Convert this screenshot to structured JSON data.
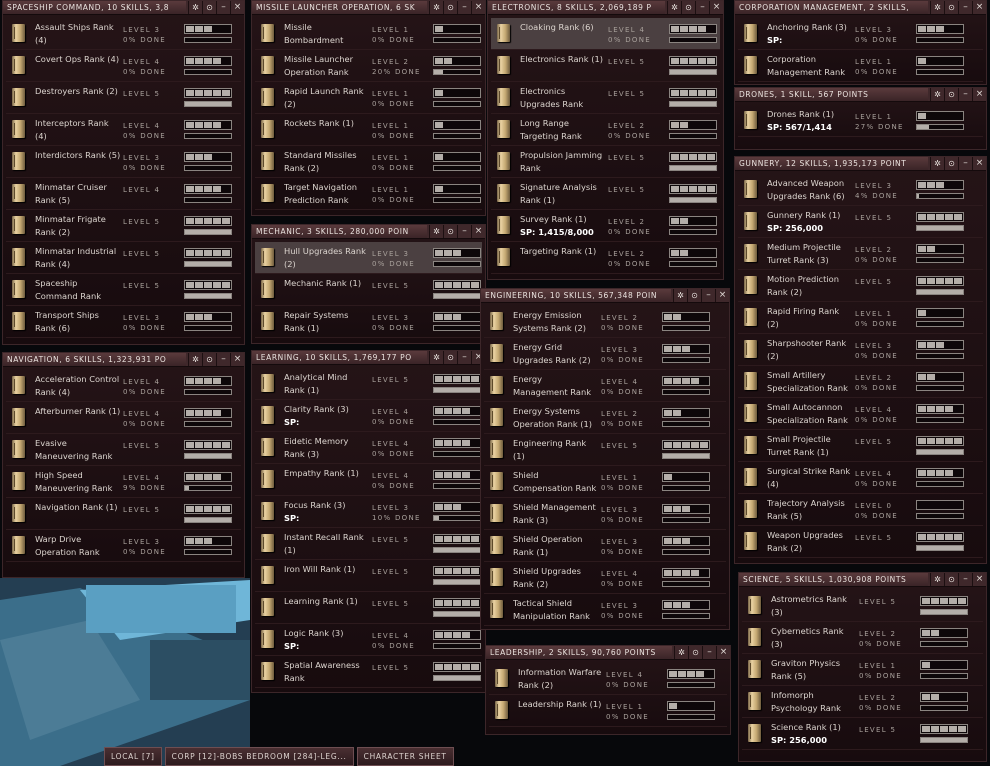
{
  "background": {
    "colors": {
      "space": "#07080b",
      "hull": "#3b6e8a"
    }
  },
  "taskbar": [
    "LOCAL [7]",
    "CORP [12]-BOBS BEDROOM [284]-LEG...",
    "CHARACTER SHEET"
  ],
  "windows": [
    {
      "title": "SPACESHIP COMMAND, 10 SKILLS, 3,8",
      "skills": [
        {
          "name": "Assault Ships Rank (4)",
          "level": "LEVEL 3",
          "level_num": 3,
          "done": "0% DONE",
          "pct": 0
        },
        {
          "name": "Covert Ops Rank (4)",
          "level": "LEVEL 4",
          "level_num": 4,
          "done": "0% DONE",
          "pct": 0
        },
        {
          "name": "Destroyers Rank (2)",
          "level": "LEVEL 5",
          "level_num": 5,
          "done": "",
          "pct": 0
        },
        {
          "name": "Interceptors Rank (4)",
          "level": "LEVEL 4",
          "level_num": 4,
          "done": "0% DONE",
          "pct": 0
        },
        {
          "name": "Interdictors Rank (5)",
          "level": "LEVEL 3",
          "level_num": 3,
          "done": "0% DONE",
          "pct": 0
        },
        {
          "name": "Minmatar Cruiser Rank (5)",
          "level": "LEVEL 4",
          "level_num": 4,
          "done": "",
          "pct": 0
        },
        {
          "name": "Minmatar Frigate Rank (2)",
          "level": "LEVEL 5",
          "level_num": 5,
          "done": "",
          "pct": 0
        },
        {
          "name": "Minmatar Industrial Rank (4)",
          "level": "LEVEL 5",
          "level_num": 5,
          "done": "",
          "pct": 0
        },
        {
          "name": "Spaceship Command Rank",
          "level": "LEVEL 5",
          "level_num": 5,
          "done": "",
          "pct": 0
        },
        {
          "name": "Transport Ships Rank (6)",
          "level": "LEVEL 3",
          "level_num": 3,
          "done": "0% DONE",
          "pct": 0
        }
      ]
    },
    {
      "title": "NAVIGATION, 6 SKILLS, 1,323,931 PO",
      "skills": [
        {
          "name": "Acceleration Control Rank (4)",
          "level": "LEVEL 4",
          "level_num": 4,
          "done": "0% DONE",
          "pct": 0
        },
        {
          "name": "Afterburner Rank (1)",
          "level": "LEVEL 4",
          "level_num": 4,
          "done": "0% DONE",
          "pct": 0
        },
        {
          "name": "Evasive Maneuvering Rank",
          "level": "LEVEL 5",
          "level_num": 5,
          "done": "",
          "pct": 0
        },
        {
          "name": "High Speed Maneuvering Rank",
          "level": "LEVEL 4",
          "level_num": 4,
          "done": "9% DONE",
          "pct": 9
        },
        {
          "name": "Navigation Rank (1)",
          "level": "LEVEL 5",
          "level_num": 5,
          "done": "",
          "pct": 0
        },
        {
          "name": "Warp Drive Operation Rank",
          "level": "LEVEL 3",
          "level_num": 3,
          "done": "0% DONE",
          "pct": 0
        }
      ]
    },
    {
      "title": "MISSILE LAUNCHER OPERATION, 6 SK",
      "skills": [
        {
          "name": "Missile Bombardment",
          "level": "LEVEL 1",
          "level_num": 1,
          "done": "0% DONE",
          "pct": 0
        },
        {
          "name": "Missile Launcher Operation Rank",
          "level": "LEVEL 2",
          "level_num": 2,
          "done": "20% DONE",
          "pct": 20
        },
        {
          "name": "Rapid Launch Rank (2)",
          "level": "LEVEL 1",
          "level_num": 1,
          "done": "0% DONE",
          "pct": 0
        },
        {
          "name": "Rockets Rank (1)",
          "level": "LEVEL 1",
          "level_num": 1,
          "done": "0% DONE",
          "pct": 0
        },
        {
          "name": "Standard Missiles Rank (2)",
          "level": "LEVEL 1",
          "level_num": 1,
          "done": "0% DONE",
          "pct": 0
        },
        {
          "name": "Target Navigation Prediction Rank",
          "level": "LEVEL 1",
          "level_num": 1,
          "done": "0% DONE",
          "pct": 0
        }
      ]
    },
    {
      "title": "MECHANIC, 3 SKILLS, 280,000 POIN",
      "skills": [
        {
          "name": "Hull Upgrades Rank (2)",
          "level": "LEVEL 3",
          "level_num": 3,
          "done": "0% DONE",
          "pct": 0,
          "selected": true
        },
        {
          "name": "Mechanic Rank (1)",
          "level": "LEVEL 5",
          "level_num": 5,
          "done": "",
          "pct": 0
        },
        {
          "name": "Repair Systems Rank (1)",
          "level": "LEVEL 3",
          "level_num": 3,
          "done": "0% DONE",
          "pct": 0
        }
      ]
    },
    {
      "title": "LEARNING, 10 SKILLS, 1,769,177 PO",
      "skills": [
        {
          "name": "Analytical Mind Rank (1)",
          "level": "LEVEL 5",
          "level_num": 5,
          "done": "",
          "pct": 0
        },
        {
          "name": "Clarity Rank (3)",
          "sp": "SP:",
          "level": "LEVEL 4",
          "level_num": 4,
          "done": "0% DONE",
          "pct": 0
        },
        {
          "name": "Eidetic Memory Rank (3)",
          "level": "LEVEL 4",
          "level_num": 4,
          "done": "0% DONE",
          "pct": 0
        },
        {
          "name": "Empathy Rank (1)",
          "level": "LEVEL 4",
          "level_num": 4,
          "done": "0% DONE",
          "pct": 0
        },
        {
          "name": "Focus Rank (3)",
          "sp": "SP:",
          "level": "LEVEL 3",
          "level_num": 3,
          "done": "10% DONE",
          "pct": 10
        },
        {
          "name": "Instant Recall Rank (1)",
          "level": "LEVEL 5",
          "level_num": 5,
          "done": "",
          "pct": 0
        },
        {
          "name": "Iron Will Rank (1)",
          "level": "LEVEL 5",
          "level_num": 5,
          "done": "",
          "pct": 0
        },
        {
          "name": "Learning Rank (1)",
          "level": "LEVEL 5",
          "level_num": 5,
          "done": "",
          "pct": 0
        },
        {
          "name": "Logic Rank (3)",
          "sp": "SP:",
          "level": "LEVEL 4",
          "level_num": 4,
          "done": "0% DONE",
          "pct": 0
        },
        {
          "name": "Spatial Awareness Rank",
          "level": "LEVEL 5",
          "level_num": 5,
          "done": "",
          "pct": 0
        }
      ]
    },
    {
      "title": "ELECTRONICS, 8 SKILLS, 2,069,189 P",
      "skills": [
        {
          "name": "Cloaking Rank (6)",
          "level": "LEVEL 4",
          "level_num": 4,
          "done": "0% DONE",
          "pct": 0,
          "selected": true
        },
        {
          "name": "Electronics Rank (1)",
          "level": "LEVEL 5",
          "level_num": 5,
          "done": "",
          "pct": 0
        },
        {
          "name": "Electronics Upgrades Rank",
          "level": "LEVEL 5",
          "level_num": 5,
          "done": "",
          "pct": 0
        },
        {
          "name": "Long Range Targeting Rank",
          "level": "LEVEL 2",
          "level_num": 2,
          "done": "0% DONE",
          "pct": 0
        },
        {
          "name": "Propulsion Jamming Rank",
          "level": "LEVEL 5",
          "level_num": 5,
          "done": "",
          "pct": 0
        },
        {
          "name": "Signature Analysis Rank (1)",
          "level": "LEVEL 5",
          "level_num": 5,
          "done": "",
          "pct": 0
        },
        {
          "name": "Survey Rank (1)",
          "sp": "SP: 1,415/8,000",
          "level": "LEVEL 2",
          "level_num": 2,
          "done": "0% DONE",
          "pct": 0
        },
        {
          "name": "Targeting Rank (1)",
          "level": "LEVEL 2",
          "level_num": 2,
          "done": "0% DONE",
          "pct": 0
        }
      ]
    },
    {
      "title": "ENGINEERING, 10 SKILLS, 567,348 POIN",
      "skills": [
        {
          "name": "Energy Emission Systems Rank (2)",
          "level": "LEVEL 2",
          "level_num": 2,
          "done": "0% DONE",
          "pct": 0
        },
        {
          "name": "Energy Grid Upgrades Rank (2)",
          "level": "LEVEL 3",
          "level_num": 3,
          "done": "0% DONE",
          "pct": 0
        },
        {
          "name": "Energy Management Rank (3)",
          "level": "LEVEL 4",
          "level_num": 4,
          "done": "0% DONE",
          "pct": 0
        },
        {
          "name": "Energy Systems Operation Rank (1)",
          "level": "LEVEL 2",
          "level_num": 2,
          "done": "0% DONE",
          "pct": 0
        },
        {
          "name": "Engineering Rank (1)",
          "level": "LEVEL 5",
          "level_num": 5,
          "done": "",
          "pct": 0
        },
        {
          "name": "Shield Compensation Rank (2)",
          "level": "LEVEL 1",
          "level_num": 1,
          "done": "0% DONE",
          "pct": 0
        },
        {
          "name": "Shield Management Rank (3)",
          "level": "LEVEL 3",
          "level_num": 3,
          "done": "0% DONE",
          "pct": 0
        },
        {
          "name": "Shield Operation Rank (1)",
          "level": "LEVEL 3",
          "level_num": 3,
          "done": "0% DONE",
          "pct": 0
        },
        {
          "name": "Shield Upgrades Rank (2)",
          "level": "LEVEL 4",
          "level_num": 4,
          "done": "0% DONE",
          "pct": 0
        },
        {
          "name": "Tactical Shield Manipulation Rank",
          "level": "LEVEL 3",
          "level_num": 3,
          "done": "0% DONE",
          "pct": 0
        }
      ]
    },
    {
      "title": "LEADERSHIP, 2 SKILLS, 90,760 POINTS",
      "skills": [
        {
          "name": "Information Warfare Rank (2)",
          "level": "LEVEL 4",
          "level_num": 4,
          "done": "0% DONE",
          "pct": 0
        },
        {
          "name": "Leadership Rank (1)",
          "level": "LEVEL 1",
          "level_num": 1,
          "done": "0% DONE",
          "pct": 0
        }
      ]
    },
    {
      "title": "CORPORATION MANAGEMENT, 2 SKILLS,",
      "skills": [
        {
          "name": "Anchoring Rank (3)",
          "sp": "SP:",
          "level": "LEVEL 3",
          "level_num": 3,
          "done": "0% DONE",
          "pct": 0
        },
        {
          "name": "Corporation Management Rank",
          "level": "LEVEL 1",
          "level_num": 1,
          "done": "0% DONE",
          "pct": 0
        }
      ]
    },
    {
      "title": "DRONES, 1 SKILL, 567 POINTS",
      "skills": [
        {
          "name": "Drones Rank (1)",
          "sp": "SP: 567/1,414",
          "level": "LEVEL 1",
          "level_num": 1,
          "done": "27% DONE",
          "pct": 27
        }
      ]
    },
    {
      "title": "GUNNERY, 12 SKILLS, 1,935,173 POINT",
      "skills": [
        {
          "name": "Advanced Weapon Upgrades Rank (6)",
          "level": "LEVEL 3",
          "level_num": 3,
          "done": "4% DONE",
          "pct": 4
        },
        {
          "name": "Gunnery Rank (1)",
          "sp": "SP: 256,000",
          "level": "LEVEL 5",
          "level_num": 5,
          "done": "",
          "pct": 0
        },
        {
          "name": "Medium Projectile Turret Rank (3)",
          "level": "LEVEL 2",
          "level_num": 2,
          "done": "0% DONE",
          "pct": 0
        },
        {
          "name": "Motion Prediction Rank (2)",
          "level": "LEVEL 5",
          "level_num": 5,
          "done": "",
          "pct": 0
        },
        {
          "name": "Rapid Firing Rank (2)",
          "level": "LEVEL 1",
          "level_num": 1,
          "done": "0% DONE",
          "pct": 0
        },
        {
          "name": "Sharpshooter Rank (2)",
          "level": "LEVEL 3",
          "level_num": 3,
          "done": "0% DONE",
          "pct": 0
        },
        {
          "name": "Small Artillery Specialization Rank",
          "level": "LEVEL 2",
          "level_num": 2,
          "done": "0% DONE",
          "pct": 0
        },
        {
          "name": "Small Autocannon Specialization Rank",
          "level": "LEVEL 4",
          "level_num": 4,
          "done": "0% DONE",
          "pct": 0
        },
        {
          "name": "Small Projectile Turret Rank (1)",
          "level": "LEVEL 5",
          "level_num": 5,
          "done": "",
          "pct": 0
        },
        {
          "name": "Surgical Strike Rank (4)",
          "level": "LEVEL 4",
          "level_num": 4,
          "done": "0% DONE",
          "pct": 0
        },
        {
          "name": "Trajectory Analysis Rank (5)",
          "level": "LEVEL 0",
          "level_num": 0,
          "done": "0% DONE",
          "pct": 0
        },
        {
          "name": "Weapon Upgrades Rank (2)",
          "level": "LEVEL 5",
          "level_num": 5,
          "done": "",
          "pct": 0
        }
      ]
    },
    {
      "title": "SCIENCE, 5 SKILLS, 1,030,908 POINTS",
      "skills": [
        {
          "name": "Astrometrics Rank (3)",
          "level": "LEVEL 5",
          "level_num": 5,
          "done": "",
          "pct": 0
        },
        {
          "name": "Cybernetics Rank (3)",
          "level": "LEVEL 2",
          "level_num": 2,
          "done": "0% DONE",
          "pct": 0
        },
        {
          "name": "Graviton Physics Rank (5)",
          "level": "LEVEL 1",
          "level_num": 1,
          "done": "0% DONE",
          "pct": 0
        },
        {
          "name": "Infomorph Psychology Rank",
          "level": "LEVEL 2",
          "level_num": 2,
          "done": "0% DONE",
          "pct": 0
        },
        {
          "name": "Science Rank (1)",
          "sp": "SP: 256,000",
          "level": "LEVEL 5",
          "level_num": 5,
          "done": "",
          "pct": 0
        }
      ]
    }
  ]
}
